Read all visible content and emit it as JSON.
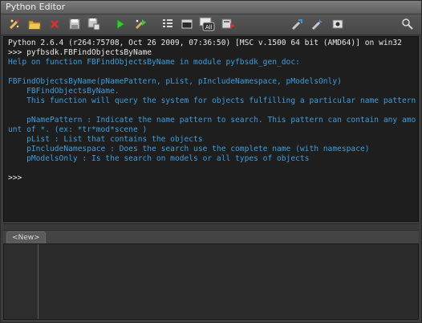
{
  "window": {
    "title": "Python Editor"
  },
  "toolbar": {
    "buttons": [
      {
        "name": "new-script-icon"
      },
      {
        "name": "open-folder-icon"
      },
      {
        "name": "close-x-icon"
      },
      {
        "name": "save-icon"
      },
      {
        "name": "save-as-icon"
      },
      {
        "name": "run-play-icon"
      },
      {
        "name": "run-selection-icon"
      },
      {
        "name": "indent-icon"
      },
      {
        "name": "window-icon"
      },
      {
        "name": "clear-all-icon",
        "label": "All"
      },
      {
        "name": "stop-icon"
      },
      {
        "name": "tool-a-icon"
      },
      {
        "name": "tool-b-icon"
      },
      {
        "name": "tool-c-icon"
      },
      {
        "name": "search-icon"
      }
    ]
  },
  "console": {
    "lines": [
      {
        "text": "Python 2.6.4 (r264:75708, Oct 26 2009, 07:36:50) [MSC v.1500 64 bit (AMD64)] on win32",
        "color": "white"
      },
      {
        "text": ">>> pyfbsdk.FBFindObjectsByName",
        "color": "white"
      },
      {
        "text": "Help on function FBFindObjectsByName in module pyfbsdk_gen_doc:",
        "color": "blue"
      },
      {
        "text": "",
        "color": "blue"
      },
      {
        "text": "FBFindObjectsByName(pNamePattern, pList, pIncludeNamespace, pModelsOnly)",
        "color": "blue"
      },
      {
        "text": "    FBFindObjectsByName.",
        "color": "blue"
      },
      {
        "text": "    This function will query the system for objects fulfilling a particular name pattern",
        "color": "blue"
      },
      {
        "text": "",
        "color": "blue"
      },
      {
        "text": "    pNamePattern : Indicate the name pattern to search. This pattern can contain any amount of *. (ex: *tr*mod*scene )",
        "color": "blue"
      },
      {
        "text": "    pList : List that contains the objects",
        "color": "blue"
      },
      {
        "text": "    pIncludeNamespace : Does the search use the complete name (with namespace)",
        "color": "blue"
      },
      {
        "text": "    pModelsOnly : Is the search on models or all types of objects",
        "color": "blue"
      },
      {
        "text": "",
        "color": "blue"
      },
      {
        "text": ">>>",
        "color": "white"
      }
    ]
  },
  "tabs": [
    {
      "label": "<New>"
    }
  ]
}
